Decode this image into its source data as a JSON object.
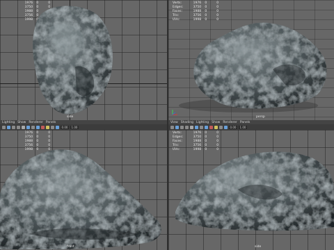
{
  "hud_labels": [
    "Verts:",
    "Edges:",
    "Faces:",
    "Tris:",
    "UVs:"
  ],
  "hud_values": [
    [
      "1976",
      "0",
      "0"
    ],
    [
      "3750",
      "0",
      "0"
    ],
    [
      "1988",
      "0",
      "0"
    ],
    [
      "3756",
      "0",
      "0"
    ],
    [
      "1998",
      "0",
      "0"
    ]
  ],
  "cameras": {
    "top_left": "side",
    "top_right": "persp",
    "bottom_left": "front",
    "bottom_right": "side"
  },
  "menus": [
    "View",
    "Shading",
    "Lighting",
    "Show",
    "Renderer",
    "Panels"
  ],
  "menus_left_visible": [
    "Lighting",
    "Show",
    "Renderer",
    "Panels"
  ],
  "toolbar_fields": [
    "0.00",
    "1.00"
  ],
  "colors": {
    "viewport_bg": "#676767",
    "grid": "#3a3a3a",
    "axis_x": "#d03a3a",
    "axis_y": "#3ad05a",
    "axis_z": "#3a6ad0",
    "rock_dark": "#2c3234",
    "rock_light": "#7d878a"
  },
  "icons": [
    "select-icon",
    "move-icon",
    "rotate-icon",
    "scale-icon",
    "camera-icon",
    "grid-icon",
    "wireframe-icon",
    "smooth-shade-icon",
    "texture-icon",
    "light-icon",
    "shadow-icon",
    "xray-icon"
  ]
}
